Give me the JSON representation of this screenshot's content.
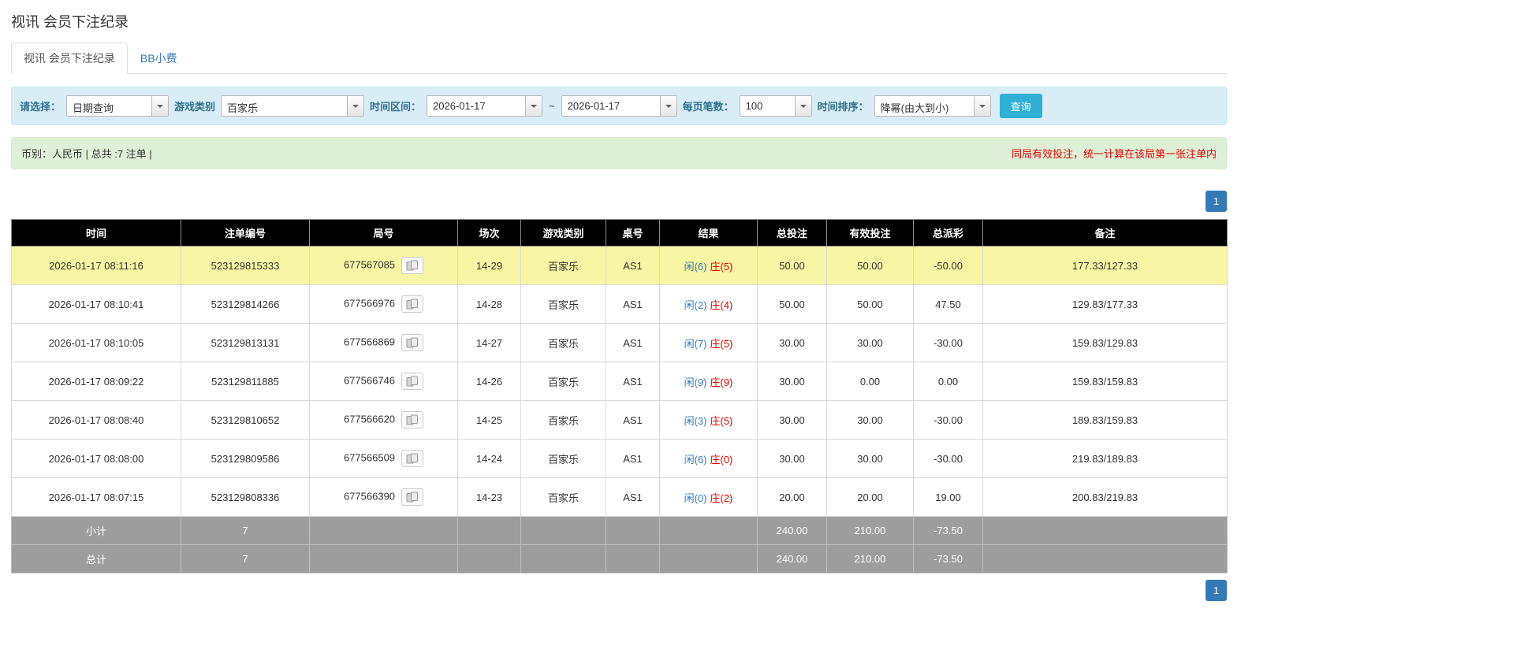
{
  "page": {
    "title": "视讯 会员下注纪录"
  },
  "tabs": [
    {
      "label": "视讯 会员下注纪录",
      "active": true
    },
    {
      "label": "BB小费",
      "active": false
    }
  ],
  "filters": {
    "select_label": "请选择：",
    "select_value": "日期查询",
    "game_type_label": "游戏类别",
    "game_type_value": "百家乐",
    "time_range_label": "时间区间：",
    "date_from": "2026-01-17",
    "date_separator": "~",
    "date_to": "2026-01-17",
    "page_size_label": "每页笔数：",
    "page_size_value": "100",
    "sort_label": "时间排序：",
    "sort_value": "降幂(由大到小)",
    "search_button": "查询"
  },
  "summary": {
    "left": "币别：人民币 | 总共 :7 注单 |",
    "right": "同局有效投注，统一计算在该局第一张注单内"
  },
  "pagination": {
    "page": "1"
  },
  "table": {
    "headers": [
      "时间",
      "注单编号",
      "局号",
      "场次",
      "游戏类别",
      "桌号",
      "结果",
      "总投注",
      "有效投注",
      "总派彩",
      "备注"
    ],
    "rows": [
      {
        "highlighted": true,
        "time": "2026-01-17 08:11:16",
        "bet_id": "523129815333",
        "round_id": "677567085",
        "session": "14-29",
        "game": "百家乐",
        "table_no": "AS1",
        "result_player": "闲(6)",
        "result_banker": "庄(5)",
        "total_bet": "50.00",
        "valid_bet": "50.00",
        "payout": "-50.00",
        "remark": "177.33/127.33"
      },
      {
        "highlighted": false,
        "time": "2026-01-17 08:10:41",
        "bet_id": "523129814266",
        "round_id": "677566976",
        "session": "14-28",
        "game": "百家乐",
        "table_no": "AS1",
        "result_player": "闲(2)",
        "result_banker": "庄(4)",
        "total_bet": "50.00",
        "valid_bet": "50.00",
        "payout": "47.50",
        "remark": "129.83/177.33"
      },
      {
        "highlighted": false,
        "time": "2026-01-17 08:10:05",
        "bet_id": "523129813131",
        "round_id": "677566869",
        "session": "14-27",
        "game": "百家乐",
        "table_no": "AS1",
        "result_player": "闲(7)",
        "result_banker": "庄(5)",
        "total_bet": "30.00",
        "valid_bet": "30.00",
        "payout": "-30.00",
        "remark": "159.83/129.83"
      },
      {
        "highlighted": false,
        "time": "2026-01-17 08:09:22",
        "bet_id": "523129811885",
        "round_id": "677566746",
        "session": "14-26",
        "game": "百家乐",
        "table_no": "AS1",
        "result_player": "闲(9)",
        "result_banker": "庄(9)",
        "total_bet": "30.00",
        "valid_bet": "0.00",
        "payout": "0.00",
        "remark": "159.83/159.83"
      },
      {
        "highlighted": false,
        "time": "2026-01-17 08:08:40",
        "bet_id": "523129810652",
        "round_id": "677566620",
        "session": "14-25",
        "game": "百家乐",
        "table_no": "AS1",
        "result_player": "闲(3)",
        "result_banker": "庄(5)",
        "total_bet": "30.00",
        "valid_bet": "30.00",
        "payout": "-30.00",
        "remark": "189.83/159.83"
      },
      {
        "highlighted": false,
        "time": "2026-01-17 08:08:00",
        "bet_id": "523129809586",
        "round_id": "677566509",
        "session": "14-24",
        "game": "百家乐",
        "table_no": "AS1",
        "result_player": "闲(6)",
        "result_banker": "庄(0)",
        "total_bet": "30.00",
        "valid_bet": "30.00",
        "payout": "-30.00",
        "remark": "219.83/189.83"
      },
      {
        "highlighted": false,
        "time": "2026-01-17 08:07:15",
        "bet_id": "523129808336",
        "round_id": "677566390",
        "session": "14-23",
        "game": "百家乐",
        "table_no": "AS1",
        "result_player": "闲(0)",
        "result_banker": "庄(2)",
        "total_bet": "20.00",
        "valid_bet": "20.00",
        "payout": "19.00",
        "remark": "200.83/219.83"
      }
    ],
    "subtotal": {
      "label": "小计",
      "count": "7",
      "total_bet": "240.00",
      "valid_bet": "210.00",
      "payout": "-73.50"
    },
    "total": {
      "label": "总计",
      "count": "7",
      "total_bet": "240.00",
      "valid_bet": "210.00",
      "payout": "-73.50"
    }
  }
}
